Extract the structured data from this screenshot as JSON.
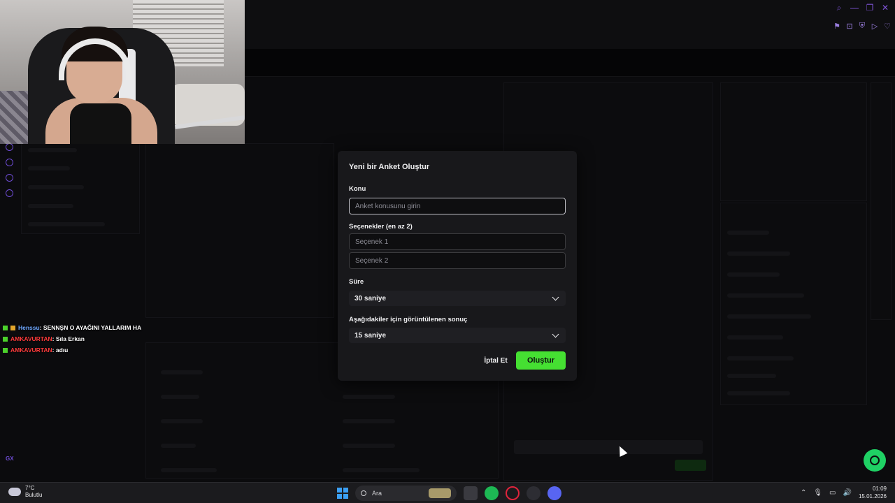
{
  "window_controls": [
    "search-icon",
    "minimize-icon",
    "restore-icon",
    "close-icon"
  ],
  "toolbar_icons": [
    "bookmark-icon",
    "crop-icon",
    "shield-icon",
    "play-icon",
    "heart-icon"
  ],
  "chat": [
    {
      "user": "Henssu",
      "message": "SENNŞN O AYAĞINI YALLARIM HA",
      "user_color": "#6fa8ff",
      "badge": "two"
    },
    {
      "user": "AMKAVURTAN",
      "message": "Sıla Erkan",
      "user_color": "#ff3b3b",
      "badge": "one"
    },
    {
      "user": "AMKAVURTAN",
      "message": "adıu",
      "user_color": "#ff3b3b",
      "badge": "one"
    }
  ],
  "chat_separator": ": ",
  "modal": {
    "title": "Yeni bir Anket Oluştur",
    "topic_label": "Konu",
    "topic_placeholder": "Anket konusunu girin",
    "options_label": "Seçenekler (en az 2)",
    "option1_placeholder": "Seçenek 1",
    "option2_placeholder": "Seçenek 2",
    "duration_label": "Süre",
    "duration_value": "30 saniye",
    "result_label": "Aşağıdakiler için görüntülenen sonuç",
    "result_value": "15 saniye",
    "cancel_label": "İptal Et",
    "create_label": "Oluştur"
  },
  "colors": {
    "accent_green": "#45e032",
    "brand_purple": "#7f54d8",
    "modal_bg": "#18181b"
  },
  "left_rail": {
    "gx_label": "GX"
  },
  "taskbar": {
    "weather_temp": "7°C",
    "weather_desc": "Bulutlu",
    "search_label": "Ara",
    "time": "01:09",
    "date": "15.01.2026"
  }
}
